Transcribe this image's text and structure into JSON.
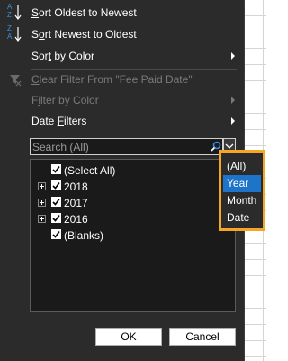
{
  "menu": {
    "sort_oldest": {
      "pre": "",
      "key": "S",
      "post": "ort Oldest to Newest"
    },
    "sort_newest": {
      "pre": "S",
      "key": "o",
      "post": "rt Newest to Oldest"
    },
    "sort_by_color": {
      "pre": "Sor",
      "key": "t",
      "post": " by Color"
    },
    "clear_filter": {
      "pre": "",
      "key": "C",
      "post": "lear Filter From \"Fee Paid Date\""
    },
    "filter_by_color": {
      "pre": "F",
      "key": "i",
      "post": "lter by Color"
    },
    "date_filters": {
      "pre": "Date ",
      "key": "F",
      "post": "ilters"
    },
    "sort_oldest_icon_top": "A",
    "sort_oldest_icon_bottom": "Z",
    "sort_newest_icon_top": "Z",
    "sort_newest_icon_bottom": "A"
  },
  "search": {
    "placeholder": "Search (All)"
  },
  "tree": {
    "items": [
      {
        "label": "(Select All)",
        "checked": true
      },
      {
        "label": "2018",
        "checked": true
      },
      {
        "label": "2017",
        "checked": true
      },
      {
        "label": "2016",
        "checked": true
      },
      {
        "label": "(Blanks)",
        "checked": true
      }
    ]
  },
  "buttons": {
    "ok": "OK",
    "cancel": "Cancel"
  },
  "popup": {
    "options": [
      "(All)",
      "Year",
      "Month",
      "Date"
    ],
    "selected": "Year"
  },
  "colors": {
    "menu_bg": "#2b2b2b",
    "popup_highlight": "#f5a623",
    "selection": "#1e74c9",
    "sort_icon_blue": "#3c8dde"
  },
  "icons": {
    "sort_ascending": "sort-ascending-icon",
    "sort_descending": "sort-descending-icon",
    "clear_filter": "clear-filter-icon",
    "search": "search-icon",
    "dropdown": "chevron-down-icon",
    "submenu": "chevron-right-icon",
    "expand": "plus-icon",
    "checkbox": "checkmark-icon"
  }
}
